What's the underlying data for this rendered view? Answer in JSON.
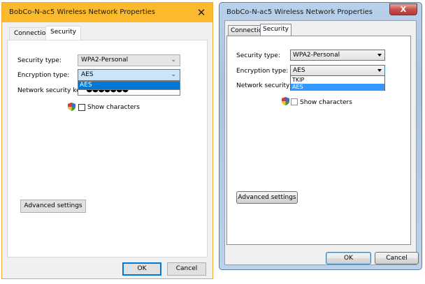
{
  "left_dialog": {
    "title": "BobCo-N-ac5 Wireless Network Properties",
    "close_glyph": "✕",
    "tabs": [
      {
        "label": "Connection",
        "active": false
      },
      {
        "label": "Security",
        "active": true
      }
    ],
    "security_type_label": "Security type:",
    "security_type_value": "WPA2-Personal",
    "encryption_type_label": "Encryption type:",
    "encryption_type_value": "AES",
    "encryption_options": [
      "AES"
    ],
    "encryption_highlighted": "AES",
    "network_key_label": "Network security key",
    "network_key_masked": "●●●●●●●",
    "show_characters_label": "Show characters",
    "show_characters_checked": false,
    "advanced_button": "Advanced settings",
    "ok_button": "OK",
    "cancel_button": "Cancel",
    "accent_color": "#fbb92e",
    "selection_color": "#0078d7"
  },
  "right_dialog": {
    "title": "BobCo-N-ac5 Wireless Network Properties",
    "close_glyph": "X",
    "tabs": [
      {
        "label": "Connection",
        "active": false
      },
      {
        "label": "Security",
        "active": true
      }
    ],
    "security_type_label": "Security type:",
    "security_type_value": "WPA2-Personal",
    "encryption_type_label": "Encryption type:",
    "encryption_type_value": "AES",
    "encryption_options": [
      "TKIP",
      "AES"
    ],
    "encryption_highlighted": "AES",
    "network_key_label": "Network security key",
    "show_characters_label": "Show characters",
    "show_characters_checked": false,
    "advanced_button": "Advanced settings",
    "ok_button": "OK",
    "cancel_button": "Cancel",
    "selection_color": "#3399ff"
  }
}
